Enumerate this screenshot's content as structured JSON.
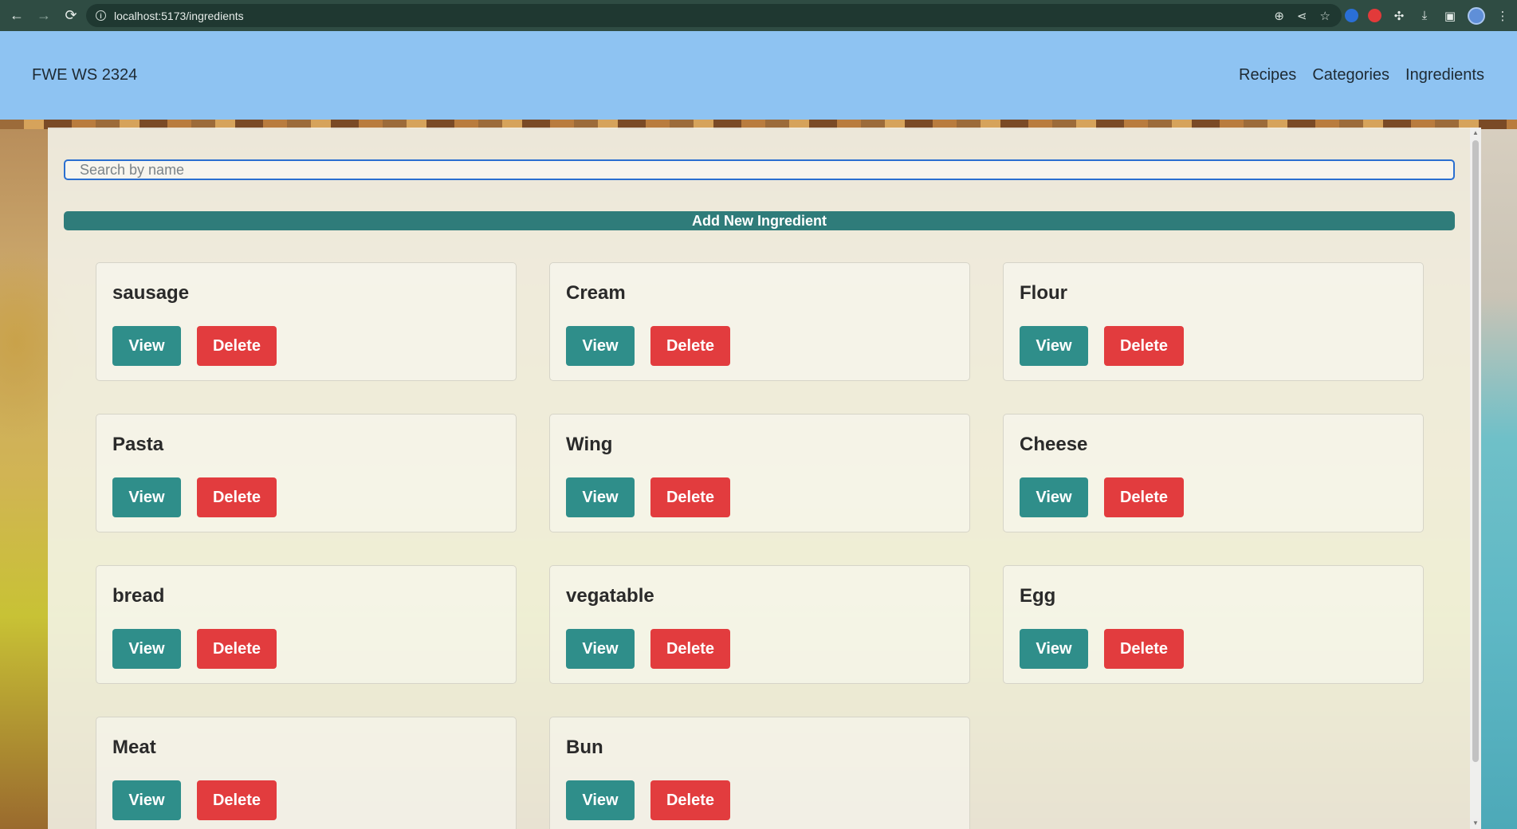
{
  "browser": {
    "url": "localhost:5173/ingredients",
    "back_icon": "←",
    "forward_icon": "→",
    "reload_icon": "⟳"
  },
  "header": {
    "brand": "FWE WS 2324",
    "nav": [
      "Recipes",
      "Categories",
      "Ingredients"
    ]
  },
  "search": {
    "placeholder": "Search by name",
    "value": ""
  },
  "add_button_label": "Add New Ingredient",
  "ingredients": [
    {
      "name": "sausage",
      "view": "View",
      "delete": "Delete"
    },
    {
      "name": "Cream",
      "view": "View",
      "delete": "Delete"
    },
    {
      "name": "Flour",
      "view": "View",
      "delete": "Delete"
    },
    {
      "name": "Pasta",
      "view": "View",
      "delete": "Delete"
    },
    {
      "name": "Wing",
      "view": "View",
      "delete": "Delete"
    },
    {
      "name": "Cheese",
      "view": "View",
      "delete": "Delete"
    },
    {
      "name": "bread",
      "view": "View",
      "delete": "Delete"
    },
    {
      "name": "vegatable",
      "view": "View",
      "delete": "Delete"
    },
    {
      "name": "Egg",
      "view": "View",
      "delete": "Delete"
    },
    {
      "name": "Meat",
      "view": "View",
      "delete": "Delete"
    },
    {
      "name": "Bun",
      "view": "View",
      "delete": "Delete"
    }
  ],
  "colors": {
    "header_bg": "#8ec3f2",
    "teal_button": "#2f8e8a",
    "red_button": "#e23c3e",
    "add_button": "#2f7c7a"
  }
}
